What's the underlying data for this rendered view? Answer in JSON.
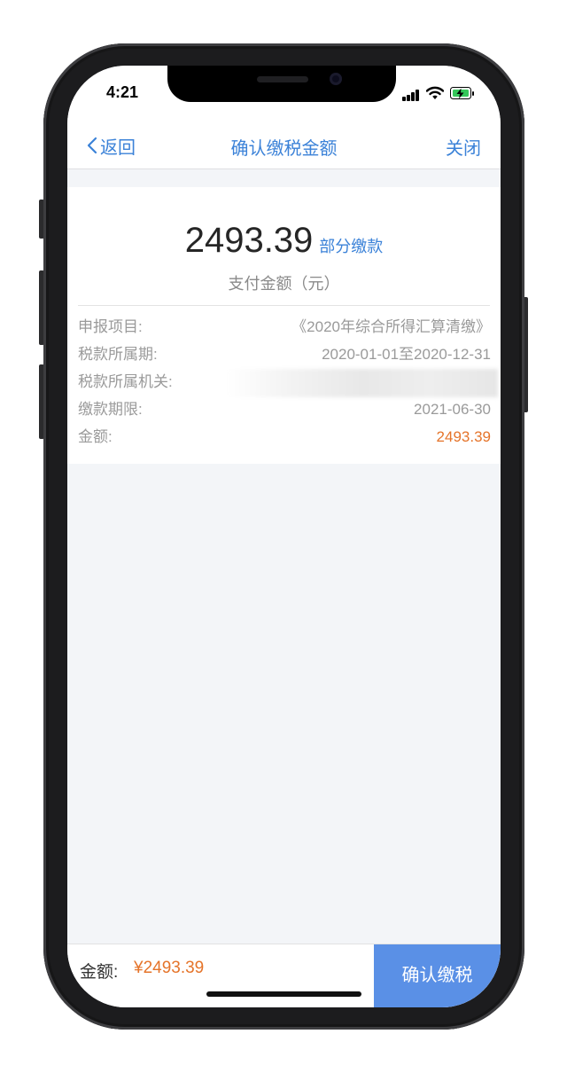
{
  "status_bar": {
    "time": "4:21"
  },
  "nav": {
    "back_label": "返回",
    "title": "确认缴税金额",
    "close_label": "关闭"
  },
  "summary": {
    "amount": "2493.39",
    "partial_pay_label": "部分缴款",
    "caption": "支付金额（元）"
  },
  "details": {
    "item_label": "申报项目:",
    "item_value": "《2020年综合所得汇算清缴》",
    "period_label": "税款所属期:",
    "period_value": "2020-01-01至2020-12-31",
    "authority_label": "税款所属机关:",
    "deadline_label": "缴款期限:",
    "deadline_value": "2021-06-30",
    "amount_label": "金额:",
    "amount_value": "2493.39"
  },
  "bottom_bar": {
    "amount_label": "金额:",
    "amount_value": "¥2493.39",
    "confirm_label": "确认缴税"
  },
  "colors": {
    "accent_blue": "#3b82d8",
    "button_blue": "#5a90e6",
    "amount_orange": "#e5742a",
    "page_background": "#f3f5f8"
  }
}
